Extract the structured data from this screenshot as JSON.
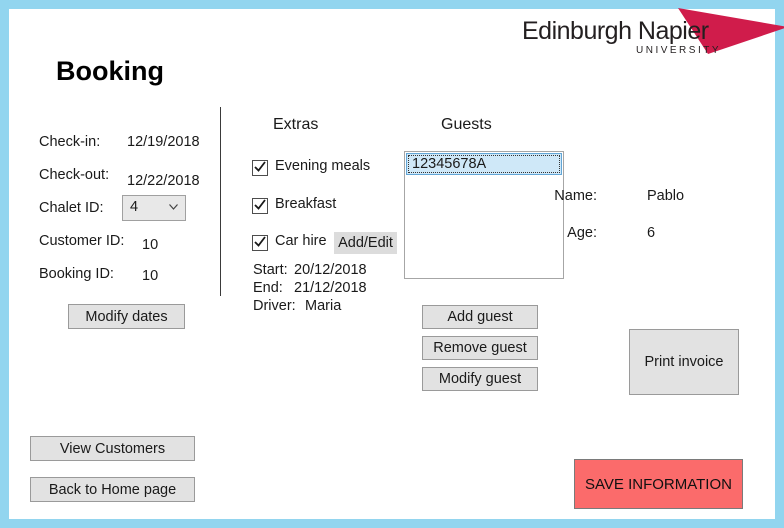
{
  "window": {
    "title": "Booking",
    "border_color": "#92d5ef",
    "background": "#ffffff"
  },
  "logo": {
    "name": "Edinburgh Napier",
    "subtitle": "UNIVERSITY",
    "mark_icon": "napier-triangle-icon",
    "mark_color": "#d01c4b"
  },
  "booking_details": {
    "checkin_label": "Check-in:",
    "checkin_value": "12/19/2018",
    "checkout_label": "Check-out:",
    "checkout_value": "12/22/2018",
    "chalet_label": "Chalet ID:",
    "chalet_value": "4",
    "chalet_options": [
      "4"
    ],
    "customer_label": "Customer ID:",
    "customer_value": "10",
    "booking_label": "Booking ID:",
    "booking_value": "10",
    "modify_dates_label": "Modify dates"
  },
  "extras": {
    "heading": "Extras",
    "items": [
      {
        "label": "Evening meals",
        "checked": true
      },
      {
        "label": "Breakfast",
        "checked": true
      },
      {
        "label": "Car hire",
        "checked": true
      }
    ],
    "add_edit_label": "Add/Edit",
    "car_hire": {
      "start_label": "Start:",
      "start_value": "20/12/2018",
      "end_label": "End:",
      "end_value": "21/12/2018",
      "driver_label": "Driver:",
      "driver_value": "Maria"
    }
  },
  "guests": {
    "heading": "Guests",
    "list": [
      {
        "id": "12345678A",
        "selected": true
      }
    ],
    "add_label": "Add guest",
    "remove_label": "Remove guest",
    "modify_label": "Modify guest"
  },
  "guest_detail": {
    "name_label": "Name:",
    "name_value": "Pablo",
    "age_label": "Age:",
    "age_value": "6"
  },
  "actions": {
    "print_invoice_label": "Print invoice",
    "view_customers_label": "View Customers",
    "back_home_label": "Back to Home page",
    "save_label": "SAVE INFORMATION",
    "save_color": "#fb6b6b"
  }
}
